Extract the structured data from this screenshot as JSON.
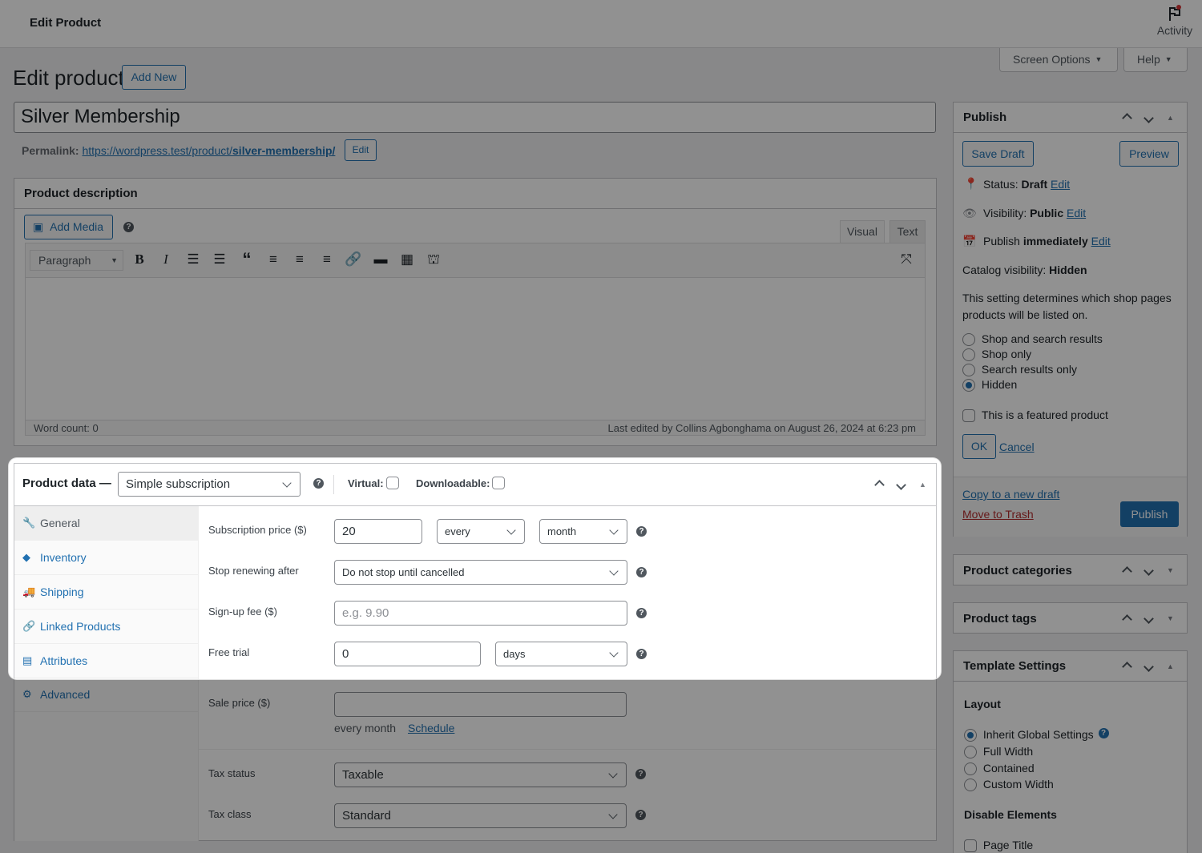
{
  "header": {
    "title": "Edit Product",
    "activity_label": "Activity",
    "screen_options_label": "Screen Options",
    "help_label": "Help"
  },
  "page": {
    "title": "Edit product",
    "add_new_label": "Add New"
  },
  "product": {
    "title_value": "Silver Membership",
    "permalink_label": "Permalink:",
    "permalink_base": "https://wordpress.test/product/",
    "permalink_slug": "silver-membership/",
    "permalink_edit_label": "Edit"
  },
  "description": {
    "heading": "Product description",
    "add_media_label": "Add Media",
    "tab_visual": "Visual",
    "tab_text": "Text",
    "format_select": "Paragraph",
    "word_count": "Word count: 0",
    "last_edited": "Last edited by Collins Agbonghama on August 26, 2024 at 6:23 pm"
  },
  "product_data": {
    "heading": "Product data —",
    "type_value": "Simple subscription",
    "virtual_label": "Virtual:",
    "downloadable_label": "Downloadable:",
    "tabs": [
      {
        "label": "General",
        "icon": "wrench-icon",
        "glyph": "🔧",
        "active": true
      },
      {
        "label": "Inventory",
        "icon": "tag-icon",
        "glyph": "◆"
      },
      {
        "label": "Shipping",
        "icon": "truck-icon",
        "glyph": "▰"
      },
      {
        "label": "Linked Products",
        "icon": "link-icon",
        "glyph": "⚭"
      },
      {
        "label": "Attributes",
        "icon": "list-icon",
        "glyph": "▤"
      },
      {
        "label": "Advanced",
        "icon": "gear-icon",
        "glyph": "⚙"
      }
    ],
    "subscription_price_label": "Subscription price ($)",
    "subscription_price_value": "20",
    "interval_value": "every",
    "period_value": "month",
    "stop_renewing_label": "Stop renewing after",
    "stop_renewing_value": "Do not stop until cancelled",
    "signup_fee_label": "Sign-up fee ($)",
    "signup_fee_placeholder": "e.g. 9.90",
    "free_trial_label": "Free trial",
    "free_trial_value": "0",
    "free_trial_period": "days",
    "sale_price_label": "Sale price ($)",
    "sale_price_value": "",
    "sale_price_suffix": "every month",
    "schedule_label": "Schedule",
    "tax_status_label": "Tax status",
    "tax_status_value": "Taxable",
    "tax_class_label": "Tax class",
    "tax_class_value": "Standard"
  },
  "publish": {
    "heading": "Publish",
    "save_draft_label": "Save Draft",
    "preview_label": "Preview",
    "status_label": "Status:",
    "status_value": "Draft",
    "visibility_label": "Visibility:",
    "visibility_value": "Public",
    "publish_label": "Publish",
    "publish_value": "immediately",
    "edit_label": "Edit",
    "catalog_visibility_label": "Catalog visibility:",
    "catalog_visibility_value": "Hidden",
    "catalog_help": "This setting determines which shop pages products will be listed on.",
    "catalog_options": [
      {
        "label": "Shop and search results",
        "checked": false
      },
      {
        "label": "Shop only",
        "checked": false
      },
      {
        "label": "Search results only",
        "checked": false
      },
      {
        "label": "Hidden",
        "checked": true
      }
    ],
    "featured_label": "This is a featured product",
    "ok_label": "OK",
    "cancel_label": "Cancel",
    "copy_draft_label": "Copy to a new draft",
    "trash_label": "Move to Trash",
    "publish_button_label": "Publish"
  },
  "categories": {
    "heading": "Product categories"
  },
  "tags": {
    "heading": "Product tags"
  },
  "template": {
    "heading": "Template Settings",
    "layout_label": "Layout",
    "layout_options": [
      {
        "label": "Inherit Global Settings",
        "checked": true
      },
      {
        "label": "Full Width",
        "checked": false
      },
      {
        "label": "Contained",
        "checked": false
      },
      {
        "label": "Custom Width",
        "checked": false
      }
    ],
    "disable_elements_label": "Disable Elements",
    "page_title_label": "Page Title"
  },
  "colors": {
    "accent": "#2271b1",
    "publish_button": "#2271b1",
    "trash_link": "#b32d2e"
  }
}
